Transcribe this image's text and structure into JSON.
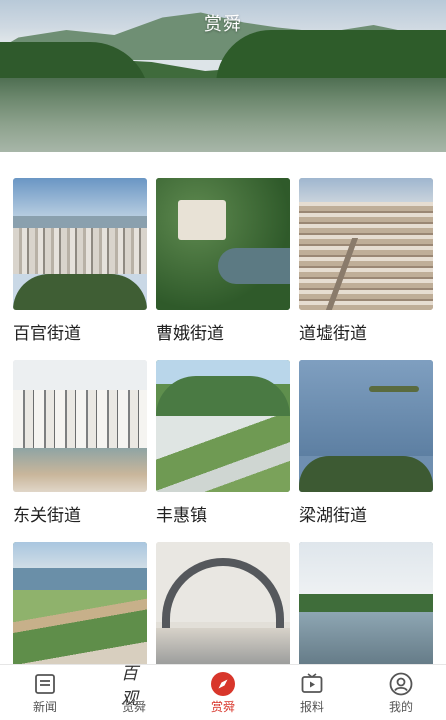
{
  "header": {
    "title": "赏舜"
  },
  "grid": {
    "items": [
      {
        "label": "百官街道"
      },
      {
        "label": "曹娥街道"
      },
      {
        "label": "道墟街道"
      },
      {
        "label": "东关街道"
      },
      {
        "label": "丰惠镇"
      },
      {
        "label": "梁湖街道"
      },
      {
        "label": ""
      },
      {
        "label": ""
      },
      {
        "label": ""
      }
    ]
  },
  "tabbar": {
    "tabs": [
      {
        "label": "新闻",
        "icon": "news-icon"
      },
      {
        "label": "览舜",
        "icon": "brand-calligraphy-icon",
        "icon_text": "百观"
      },
      {
        "label": "赏舜",
        "icon": "compass-icon",
        "active": true
      },
      {
        "label": "报料",
        "icon": "tv-play-icon"
      },
      {
        "label": "我的",
        "icon": "user-icon"
      }
    ]
  },
  "colors": {
    "accent": "#d8362b",
    "tab_text": "#555555",
    "label_text": "#222222"
  }
}
